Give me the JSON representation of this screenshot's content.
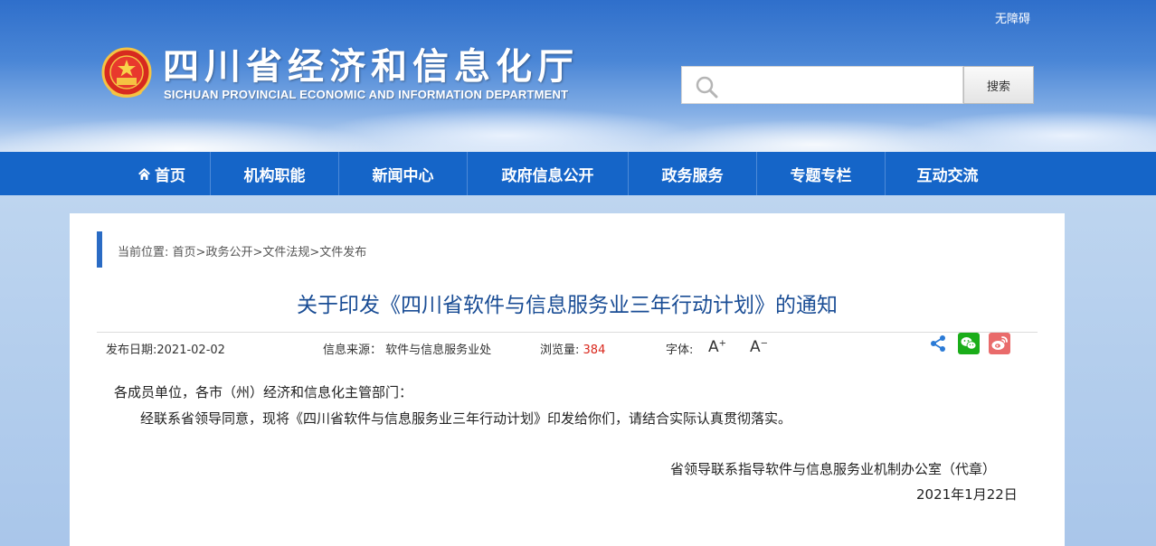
{
  "header": {
    "accessibility": "无障碍",
    "title": "四川省经济和信息化厅",
    "subtitle": "SICHUAN PROVINCIAL ECONOMIC AND INFORMATION DEPARTMENT",
    "search": {
      "placeholder": "",
      "button": "搜索"
    }
  },
  "nav": {
    "items": [
      "首页",
      "机构职能",
      "新闻中心",
      "政府信息公开",
      "政务服务",
      "专题专栏",
      "互动交流"
    ]
  },
  "breadcrumb": {
    "prefix": "当前位置:",
    "items": [
      "首页",
      "政务公开",
      "文件法规",
      "文件发布"
    ],
    "separator": ">"
  },
  "article": {
    "title": "关于印发《四川省软件与信息服务业三年行动计划》的通知",
    "meta": {
      "date_label": "发布日期:",
      "date": "2021-02-02",
      "source_label": "信息来源：",
      "source": "软件与信息服务业处",
      "views_label": "浏览量:",
      "views": "384",
      "font_label": "字体:",
      "font_increase": "A",
      "font_decrease": "A"
    },
    "salutation": "各成员单位，各市（州）经济和信息化主管部门：",
    "paragraph": "经联系省领导同意，现将《四川省软件与信息服务业三年行动计划》印发给你们，请结合实际认真贯彻落实。",
    "signature": "省领导联系指导软件与信息服务业机制办公室（代章）",
    "sign_date": "2021年1月22日"
  },
  "colors": {
    "nav_bg": "#1565c8",
    "title": "#1a4d95",
    "views": "#d9271c",
    "wechat": "#1aad19",
    "weibo": "#e96b6b",
    "share": "#2a7ad6"
  }
}
